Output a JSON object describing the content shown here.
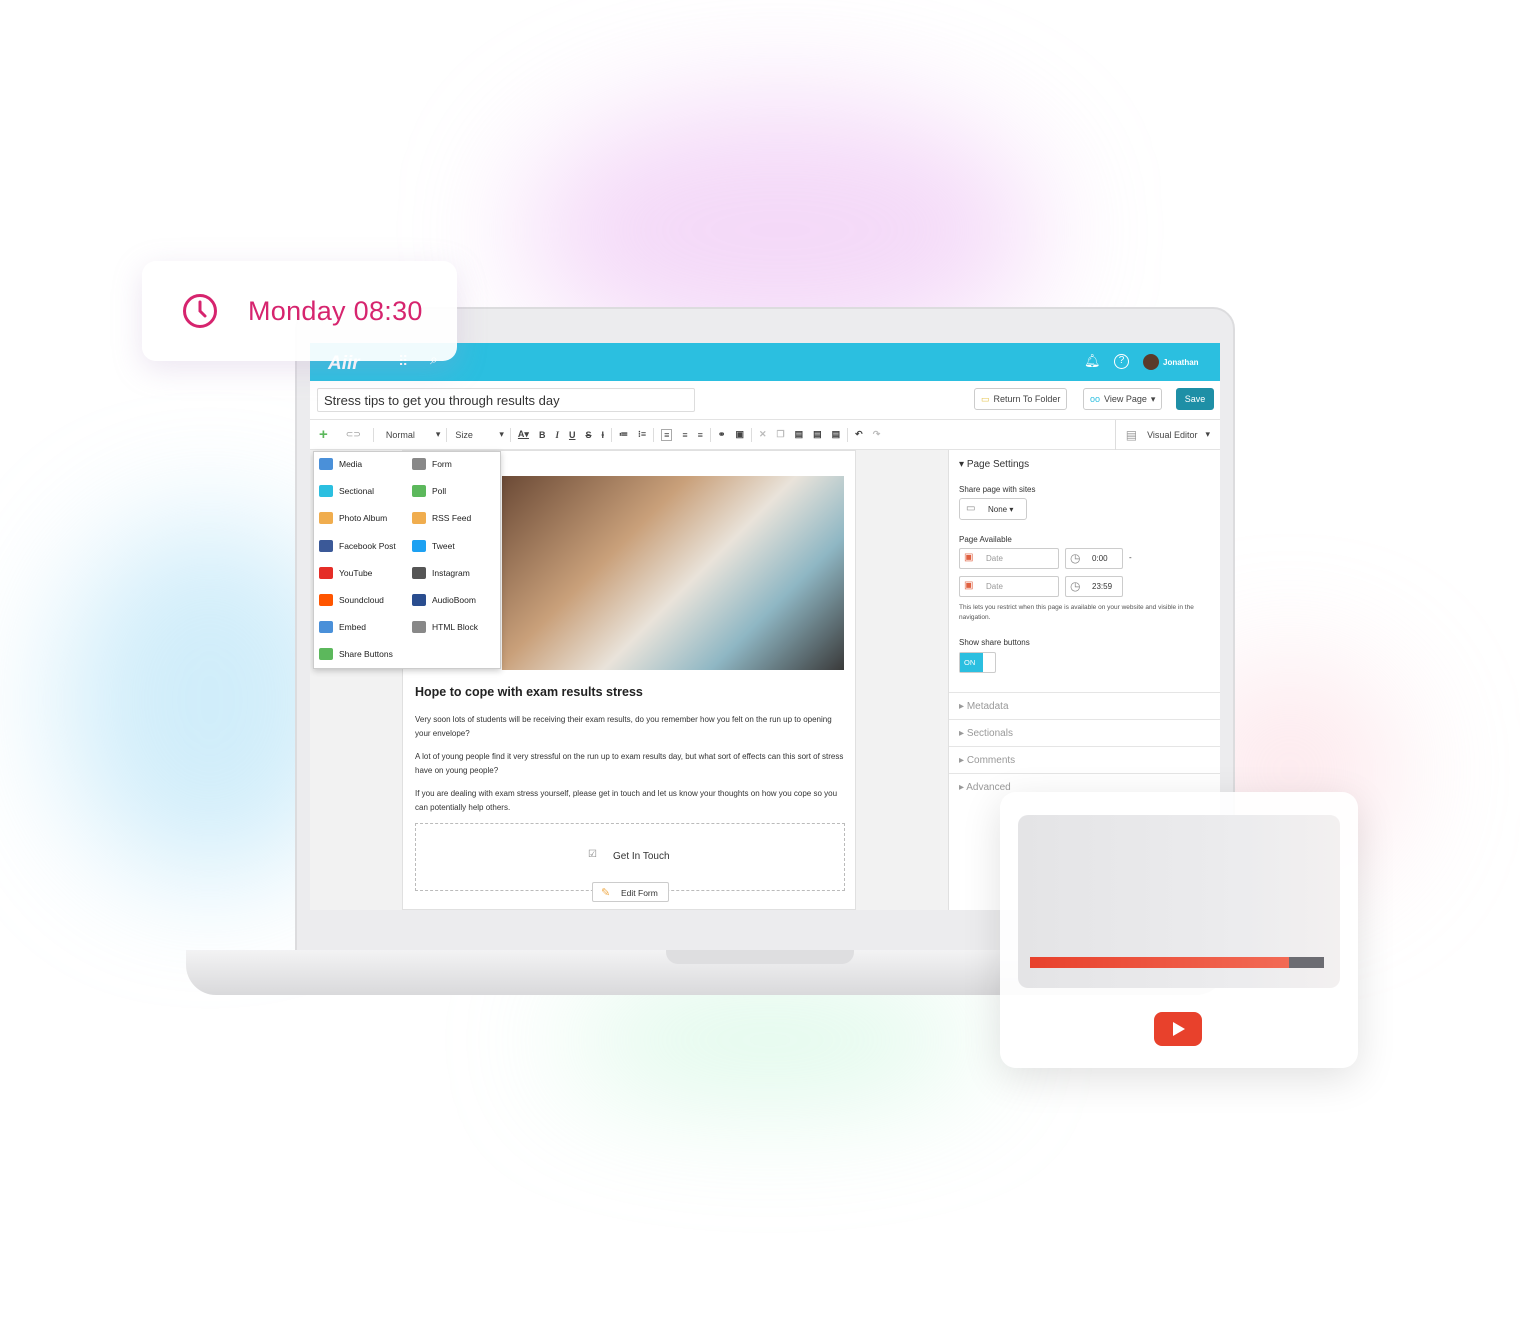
{
  "clock_card": {
    "time_label": "Monday 08:30",
    "icon": "clock-icon",
    "color": "#d6246e"
  },
  "app": {
    "logo": "Aiir",
    "header_color": "#2bbfe0",
    "user_name": "Jonathan",
    "icons": [
      "apps-grid-icon",
      "search-icon",
      "bell-icon",
      "help-icon"
    ]
  },
  "title_row": {
    "page_title_value": "Stress tips to get you through results day",
    "return_label": "Return To Folder",
    "view_page_label": "View Page",
    "save_label": "Save"
  },
  "toolbar": {
    "format_select": "Normal",
    "size_select": "Size",
    "editor_mode": "Visual Editor",
    "buttons": [
      "B",
      "I",
      "U",
      "S"
    ]
  },
  "insert_menu": {
    "items": [
      {
        "label": "Media",
        "icon": "media-icon",
        "color": "#4a90d9"
      },
      {
        "label": "Form",
        "icon": "form-icon",
        "color": "#888"
      },
      {
        "label": "Sectional",
        "icon": "sectional-icon",
        "color": "#2bbfe0"
      },
      {
        "label": "Poll",
        "icon": "poll-icon",
        "color": "#5cb85c"
      },
      {
        "label": "Photo Album",
        "icon": "photo-album-icon",
        "color": "#f0ad4e"
      },
      {
        "label": "RSS Feed",
        "icon": "rss-icon",
        "color": "#f0ad4e"
      },
      {
        "label": "Facebook Post",
        "icon": "facebook-icon",
        "color": "#3b5998"
      },
      {
        "label": "Tweet",
        "icon": "twitter-icon",
        "color": "#1da1f2"
      },
      {
        "label": "YouTube",
        "icon": "youtube-icon",
        "color": "#e52d27"
      },
      {
        "label": "Instagram",
        "icon": "instagram-icon",
        "color": "#555"
      },
      {
        "label": "Soundcloud",
        "icon": "soundcloud-icon",
        "color": "#ff5500"
      },
      {
        "label": "AudioBoom",
        "icon": "audioboom-icon",
        "color": "#2a4d8f"
      },
      {
        "label": "Embed",
        "icon": "embed-icon",
        "color": "#4a90d9"
      },
      {
        "label": "HTML Block",
        "icon": "html-block-icon",
        "color": "#888"
      },
      {
        "label": "Share Buttons",
        "icon": "share-icon",
        "color": "#5cb85c"
      }
    ]
  },
  "article": {
    "heading": "Hope to cope with exam results stress",
    "paragraphs": [
      "Very soon lots of students will be receiving their exam results, do you remember how you felt on the run up to opening your envelope?",
      "A lot of young people find it very stressful on the run up to exam results day, but what sort of effects can this sort of stress have on young people?",
      "If you are dealing with exam stress yourself, please get in touch and let us know your thoughts on how you cope so you can potentially help others."
    ],
    "form_block_label": "Get In Touch",
    "edit_form_label": "Edit Form"
  },
  "page_settings": {
    "title": "Page Settings",
    "share_label": "Share page with sites",
    "share_value": "None",
    "available_label": "Page Available",
    "start_date_placeholder": "Date",
    "start_time": "0:00",
    "end_date_placeholder": "Date",
    "end_time": "23:59",
    "separator": "-",
    "help_text": "This lets you restrict when this page is available on your website and visible in the navigation.",
    "share_buttons_label": "Show share buttons",
    "toggle_label": "ON",
    "toggle_on": true,
    "sections": [
      "Metadata",
      "Sectionals",
      "Comments",
      "Advanced"
    ]
  },
  "video_card": {
    "progress_percent": 88,
    "progress_color": "#e8412c",
    "play_icon": "youtube-play-icon"
  }
}
